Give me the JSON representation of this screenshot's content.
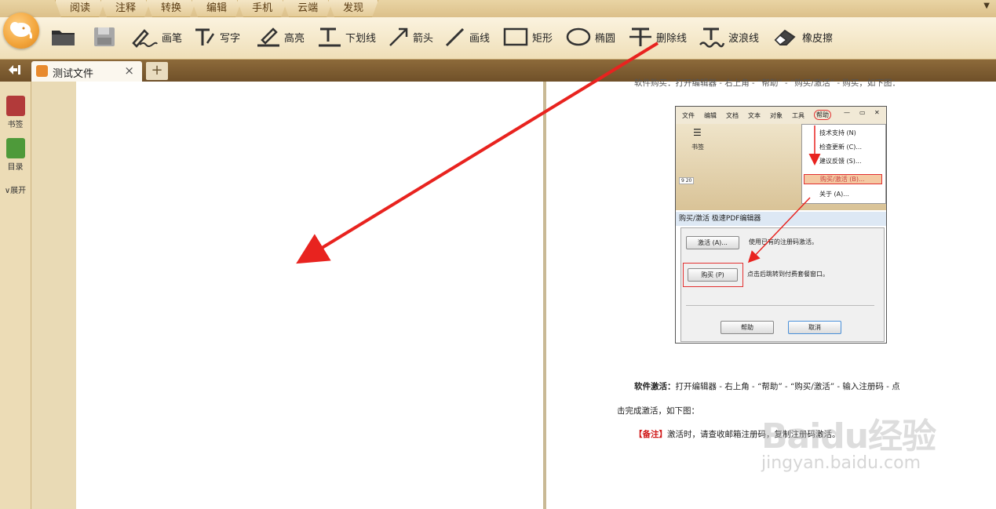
{
  "menu_tabs": [
    "阅读",
    "注释",
    "转换",
    "编辑",
    "手机",
    "云端",
    "发现"
  ],
  "toolbar": {
    "tools": [
      {
        "key": "open",
        "label": "",
        "icon": "folder-icon"
      },
      {
        "key": "save",
        "label": "",
        "icon": "save-icon"
      },
      {
        "key": "pen",
        "label": "画笔",
        "icon": "pen-icon"
      },
      {
        "key": "write",
        "label": "写字",
        "icon": "text-tool-icon"
      },
      {
        "key": "highlight",
        "label": "高亮",
        "icon": "highlight-icon"
      },
      {
        "key": "underline",
        "label": "下划线",
        "icon": "underline-icon"
      },
      {
        "key": "arrow",
        "label": "箭头",
        "icon": "arrow-icon"
      },
      {
        "key": "line",
        "label": "画线",
        "icon": "line-icon"
      },
      {
        "key": "rect",
        "label": "矩形",
        "icon": "rectangle-icon"
      },
      {
        "key": "ellipse",
        "label": "椭圆",
        "icon": "ellipse-icon"
      },
      {
        "key": "strike",
        "label": "删除线",
        "icon": "strikethrough-icon"
      },
      {
        "key": "wave",
        "label": "波浪线",
        "icon": "wavy-line-icon"
      },
      {
        "key": "eraser",
        "label": "橡皮擦",
        "icon": "eraser-icon"
      }
    ]
  },
  "tabs": {
    "doc_name": "测试文件",
    "close": "×",
    "add": "+"
  },
  "sidebar": {
    "bookmark": "书签",
    "toc": "目录",
    "expand": "展开"
  },
  "right_page": {
    "top_line": "软件购买：打开编辑器 - 右上角 - “帮助” - “购买/激活” - 购买，如下图：",
    "activate_line1_bold": "软件激活：",
    "activate_line1": "打开编辑器 - 右上角 - “帮助” - “购买/激活” - 输入注册码 - 点",
    "activate_line2": "击完成激活，如下图：",
    "note_tag": "【备注】",
    "note_text": "激活时，请查收邮箱注册码，复制注册码激活。"
  },
  "embedded": {
    "menubar": [
      "文件",
      "编辑",
      "文档",
      "文本",
      "对象",
      "工具",
      "帮助"
    ],
    "bookmark_label": "书签",
    "menu_items": [
      "技术支持 (N)",
      "检查更新 (C)...",
      "建议反馈 (S)...",
      "购买/激活 (B)...",
      "关于 (A)..."
    ],
    "dialog_title": "购买/激活 极速PDF编辑器",
    "activate_btn": "激活 (A)...",
    "activate_desc": "使用已有的注册码激活。",
    "buy_btn": "购买 (P)",
    "buy_desc": "点击后跳转到付费套餐窗口。",
    "help_btn": "帮助",
    "cancel_btn": "取消",
    "page_nav": "9 20"
  },
  "watermark": {
    "brand": "Baidu经验",
    "url": "jingyan.baidu.com"
  },
  "colors": {
    "annotation_arrow": "#e8231f",
    "toolbar_bg": "#f6ebd0",
    "tabbar_bg": "#7d5d33"
  }
}
